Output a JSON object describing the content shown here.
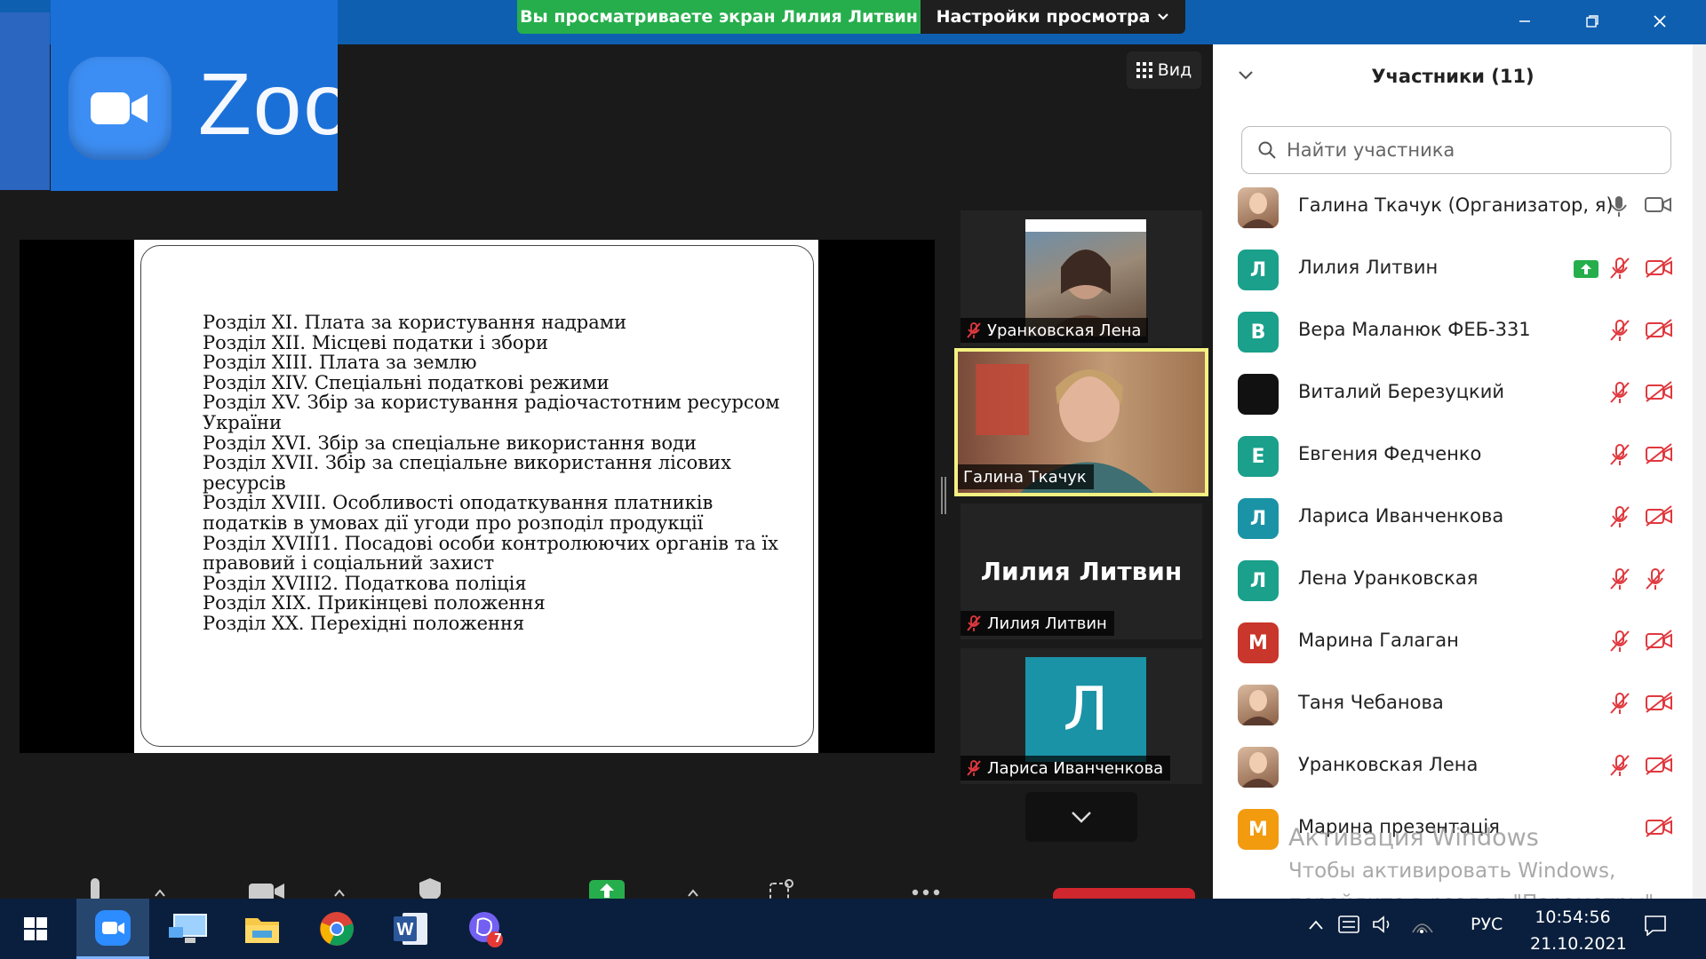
{
  "top_bar": {
    "share_banner": "Вы просматриваете экран Лилия Литвин",
    "view_options": "Настройки просмотра"
  },
  "splash": {
    "wordmark": "Zoo"
  },
  "main": {
    "view_button": "Вид",
    "slide_lines": [
      "Розділ XI. Плата за користування надрами",
      "Розділ XII. Місцеві податки і збори",
      "Розділ XIII. Плата за землю",
      "Розділ XIV. Спеціальні податкові режими",
      "Розділ XV. Збір за користування радіочастотним ресурсом",
      "України",
      "Розділ XVI. Збір за спеціальне використання води",
      "Розділ XVII. Збір за спеціальне використання лісових",
      "ресурсів",
      "Розділ XVIII. Особливості оподаткування платників",
      "податків в умовах дії угоди про розподіл продукції",
      "Розділ XVIII1. Посадові особи контролюючих органів та їх",
      "правовий і соціальний захист",
      "Розділ XVIII2. Податкова поліція",
      "Розділ XIX. Прикінцеві положення",
      "Розділ XX. Перехідні положення"
    ]
  },
  "thumbnails": [
    {
      "name": "Уранковская Лена",
      "muted": true
    },
    {
      "name": "Галина Ткачук",
      "muted": false
    },
    {
      "name": "Лилия Литвин",
      "big_name": "Лилия Литвин",
      "muted": true
    },
    {
      "name": "Лариса Иванченкова",
      "initial": "Л",
      "muted": true
    }
  ],
  "participants": {
    "title": "Участники (11)",
    "search_placeholder": "Найти участника",
    "list": [
      {
        "name": "Галина Ткачук (Организатор, я)",
        "avatar": "photo",
        "mic": "on",
        "video": "on"
      },
      {
        "name": "Лилия Литвин",
        "initial": "Л",
        "color": "#1aa08b",
        "sharing": true,
        "mic": "muted",
        "video": "off"
      },
      {
        "name": "Вера Маланюк ФЕБ-331",
        "initial": "В",
        "color": "#1aa08b",
        "mic": "muted",
        "video": "off"
      },
      {
        "name": "Виталий Березуцкий",
        "avatar": "dark",
        "mic": "muted",
        "video": "off"
      },
      {
        "name": "Евгения Федченко",
        "initial": "Е",
        "color": "#1aa08b",
        "mic": "muted",
        "video": "off"
      },
      {
        "name": "Лариса Иванченкова",
        "initial": "Л",
        "color": "#1b93a6",
        "mic": "muted",
        "video": "off"
      },
      {
        "name": "Лена Уранковская",
        "initial": "Л",
        "color": "#1aa08b",
        "mic": "muted",
        "video": "none"
      },
      {
        "name": "Марина Галаган",
        "initial": "М",
        "color": "#c9362b",
        "mic": "muted",
        "video": "off"
      },
      {
        "name": "Таня Чебанова",
        "avatar": "photo",
        "mic": "muted",
        "video": "off"
      },
      {
        "name": "Уранковская Лена",
        "avatar": "photo",
        "mic": "muted",
        "video": "off"
      },
      {
        "name": "Марина презентація",
        "initial": "М",
        "color": "#f29b0f",
        "mic": "none",
        "video": "off"
      }
    ]
  },
  "activation": {
    "line1": "Активация Windows",
    "line2": "Чтобы активировать Windows,",
    "line3": "перейдите в раздел \"Параметры\"."
  },
  "taskbar": {
    "language": "РУС",
    "time": "10:54:56",
    "date": "21.10.2021",
    "viber_badge": "7"
  }
}
